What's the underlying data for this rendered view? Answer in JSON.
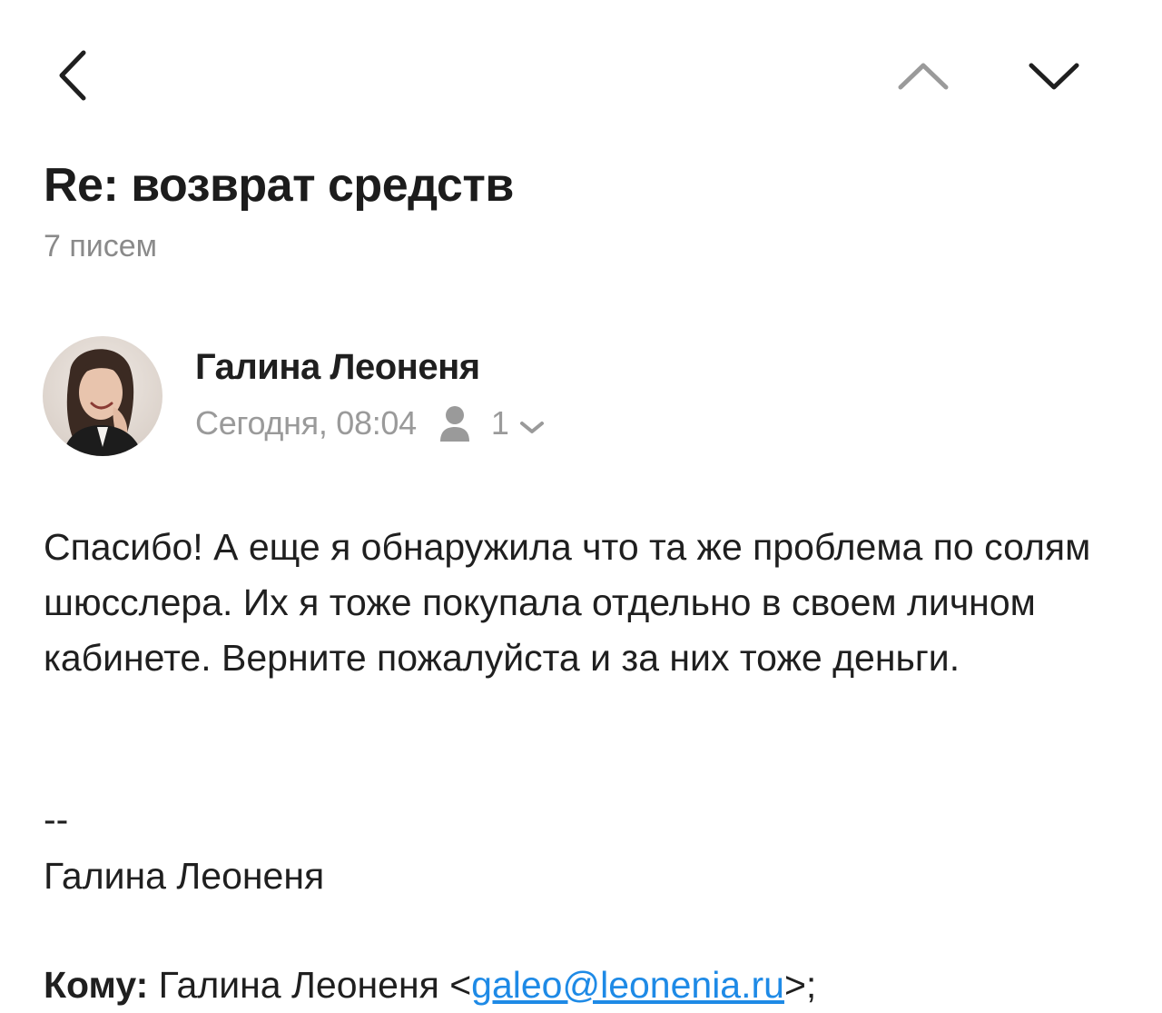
{
  "nav": {
    "back_icon": "chevron-left-icon",
    "prev_icon": "chevron-up-icon",
    "next_icon": "chevron-down-icon"
  },
  "thread": {
    "subject": "Re: возврат средств",
    "count": "7 писем"
  },
  "message": {
    "sender_name": "Галина Леоненя",
    "date": "Сегодня, 08:04",
    "recipients_count": "1",
    "body": "Спасибо! А еще я обнаружила что та же проблема по солям шюсслера. Их я тоже покупала отдельно в своем личном кабинете. Верните пожалуйста и за них тоже деньги.",
    "signature_dash": "--",
    "signature_name": "Галина Леоненя",
    "to_label": "Кому:",
    "to_name": "Галина Леоненя <",
    "to_email": "galeo@leonenia.ru",
    "to_suffix": ">;"
  },
  "colors": {
    "text": "#1f1f1f",
    "secondary": "#9a9a9a",
    "link": "#1e8ae6"
  }
}
